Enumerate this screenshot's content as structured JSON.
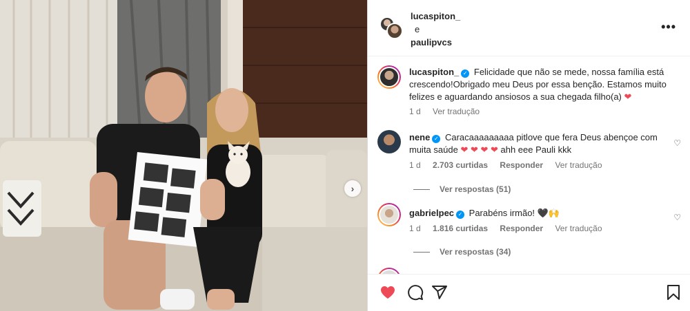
{
  "header": {
    "user1": "lucaspiton_",
    "conjunction": "e",
    "user2": "paulipvcs",
    "more_icon": "more-horizontal-icon"
  },
  "caption": {
    "username": "lucaspiton_",
    "text": "Felicidade que não se mede, nossa família está crescendo!Obrigado meu Deus por essa benção. Estamos muito felizes e aguardando ansiosos a sua chegada filho(a)",
    "heart": "❤",
    "time": "1 d",
    "translate": "Ver tradução"
  },
  "comments": [
    {
      "username": "nene",
      "text": "Caracaaaaaaaaa pitlove que fera Deus abençoe com muita saúde",
      "hearts": "❤ ❤ ❤ ❤",
      "tail": "ahh eee Pauli kkk",
      "time": "1 d",
      "likes": "2.703 curtidas",
      "reply": "Responder",
      "translate": "Ver tradução",
      "view_replies": "Ver respostas (51)"
    },
    {
      "username": "gabrielpec",
      "text": "Parabéns irmão!",
      "emoji": "🖤🙌",
      "time": "1 d",
      "likes": "1.816 curtidas",
      "reply": "Responder",
      "translate": "Ver tradução",
      "view_replies": "Ver respostas (34)"
    }
  ],
  "actions": {
    "like_icon": "heart-filled-icon",
    "comment_icon": "comment-icon",
    "share_icon": "share-icon",
    "save_icon": "bookmark-icon"
  },
  "colors": {
    "verified": "#0095f6",
    "heart": "#ed4956",
    "muted": "#737373"
  }
}
